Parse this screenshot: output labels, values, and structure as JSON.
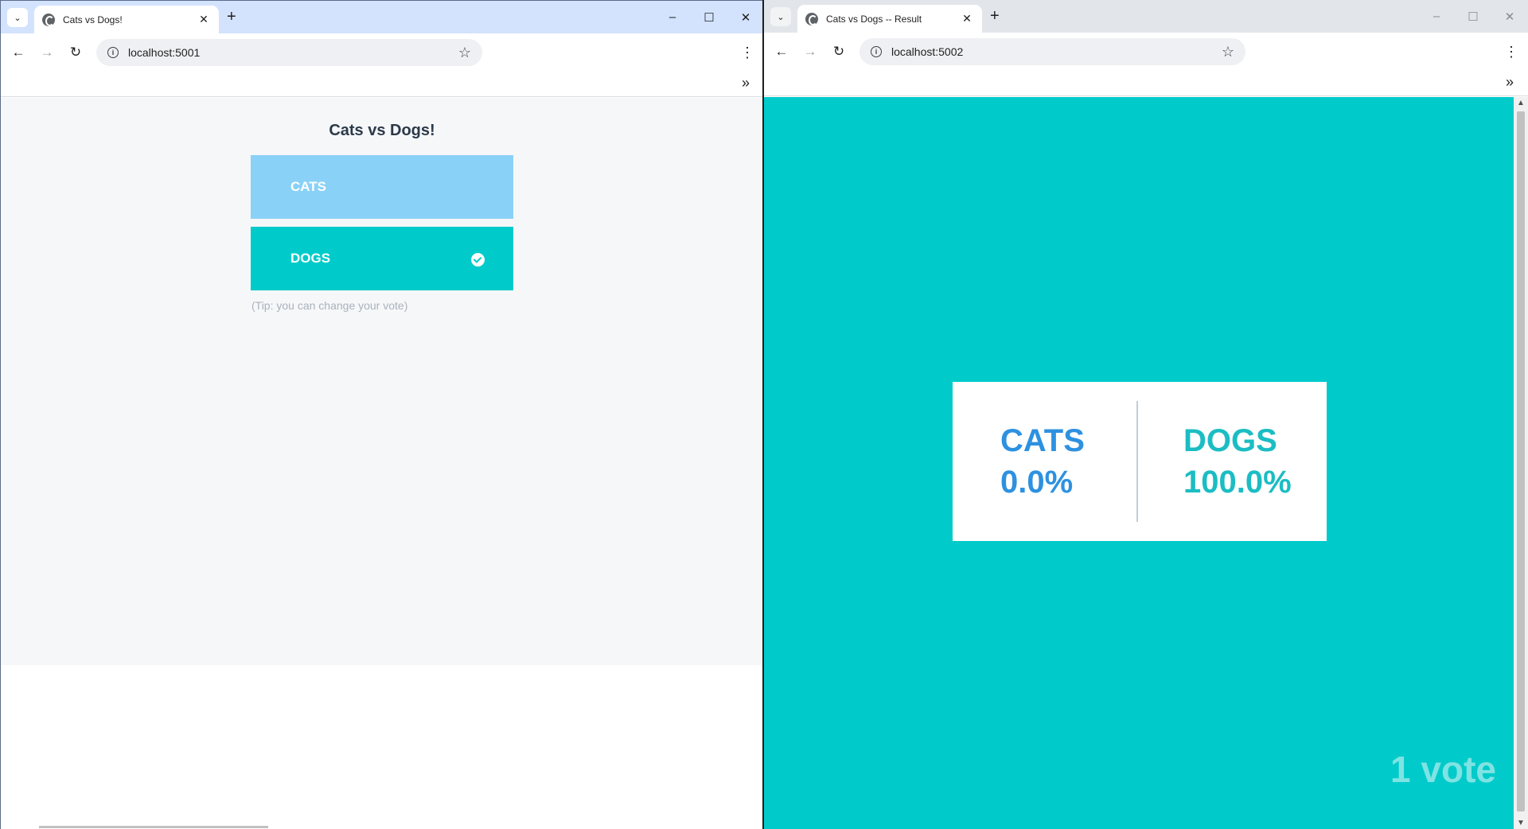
{
  "left_window": {
    "tab_title": "Cats vs Dogs!",
    "url": "localhost:5001",
    "page": {
      "title": "Cats vs Dogs!",
      "options": [
        {
          "label": "CATS",
          "selected": false,
          "color": "#8ad1f7"
        },
        {
          "label": "DOGS",
          "selected": true,
          "color": "#00cbca"
        }
      ],
      "tip": "(Tip: you can change your vote)"
    }
  },
  "right_window": {
    "tab_title": "Cats vs Dogs -- Result",
    "url": "localhost:5002",
    "page": {
      "background_color": "#00cbca",
      "cats": {
        "label": "CATS",
        "percent": "0.0%",
        "color": "#2e91e0"
      },
      "dogs": {
        "label": "DOGS",
        "percent": "100.0%",
        "color": "#1bbdc3"
      },
      "vote_count": "1 vote"
    }
  },
  "icons": {
    "tab_search": "chevron-down-icon",
    "favicon": "globe-icon",
    "close": "close-icon",
    "new_tab": "plus-icon",
    "back": "arrow-left-icon",
    "forward": "arrow-right-icon",
    "reload": "reload-icon",
    "site_info": "info-icon",
    "bookmark": "star-icon",
    "menu": "kebab-menu-icon",
    "bookmarks_overflow": "double-chevron-icon",
    "selected_check": "check-circle-icon"
  }
}
